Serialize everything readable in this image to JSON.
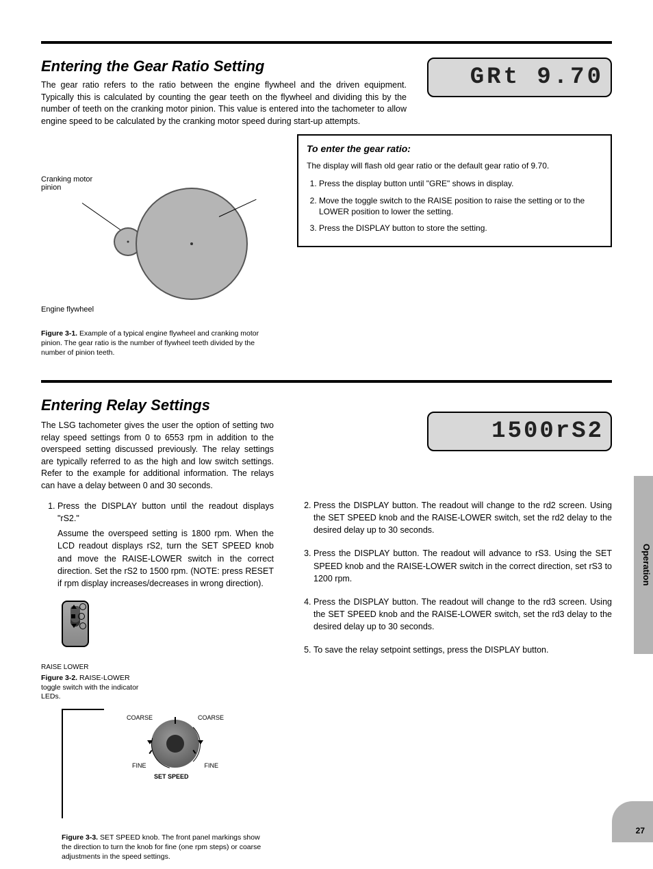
{
  "side_tab": "Operation",
  "page_number": "27",
  "section1": {
    "heading": "Entering the Gear Ratio Setting",
    "lcd": "GRt 9.70",
    "para": "The gear ratio refers to the ratio between the engine flywheel and the driven equipment. Typically this is calculated by counting the gear teeth on the flywheel and dividing this by the number of teeth on the cranking motor pinion. This value is entered into the tachometer to allow engine speed to be calculated by the cranking motor speed during start-up attempts.",
    "box_heading": "To enter the gear ratio:",
    "box_para": "The display will flash old gear ratio or the default gear ratio of 9.70.",
    "box_steps": [
      "Press the display button until \"GRE\" shows in display.",
      "Move the toggle switch to the RAISE position to raise the setting or to the LOWER position to lower the setting.",
      "Press the DISPLAY button to store the setting."
    ],
    "fig_caption_label": "Figure 3-1.",
    "fig_caption_text": "Example of a typical engine flywheel and cranking motor pinion. The gear ratio is the number of flywheel teeth divided by the number of pinion teeth.",
    "label_pinion": "Cranking motor pinion",
    "label_flywheel": "Engine flywheel"
  },
  "section2": {
    "heading": "Entering Relay Settings",
    "lcd": "1500rS2",
    "lead": "The LSG tachometer gives the user the option of setting two relay speed settings from 0 to 6553 rpm in addition to the overspeed setting discussed previously. The relay settings are typically referred to as the high and low switch settings. Refer to the example for additional information. The relays can have a delay between 0 and 30 seconds.",
    "steps": [
      "Assume the overspeed setting is 1800 rpm. When the LCD readout displays rS2, turn the SET SPEED knob and move the RAISE-LOWER switch in the correct direction. Set the rS2 to 1500 rpm. (NOTE: press RESET if rpm display increases/decreases in wrong direction).",
      "Press the DISPLAY button. The readout will change to the rd2 screen. Using the SET SPEED knob and the RAISE-LOWER switch, set the rd2 delay to the desired delay up to 30 seconds.",
      "Press the DISPLAY button. The readout will advance to rS3. Using the SET SPEED knob and the RAISE-LOWER switch in the correct direction, set rS3 to 1200 rpm.",
      "Press the DISPLAY button. The readout will change to the rd3 screen. Using the SET SPEED knob and the RAISE-LOWER switch, set the rd3 delay to the desired delay up to 30 seconds.",
      "To save the relay setpoint settings, press the DISPLAY button."
    ],
    "step1_sub": "Press the DISPLAY button until the readout displays \"rS2.\"",
    "fig32_caption_label": "Figure 3-2.",
    "fig32_caption_text": "RAISE-LOWER toggle switch with the indicator LEDs.",
    "fig32_switch_bottom": "RAISE LOWER",
    "fig33_caption_label": "Figure 3-3.",
    "fig33_caption_text": "SET SPEED knob. The front panel markings show the direction to turn the knob for fine (one rpm steps) or coarse adjustments in the speed settings.",
    "fig33_labels": {
      "coarse": "COARSE",
      "fine": "FINE",
      "set_speed": "SET SPEED"
    }
  }
}
